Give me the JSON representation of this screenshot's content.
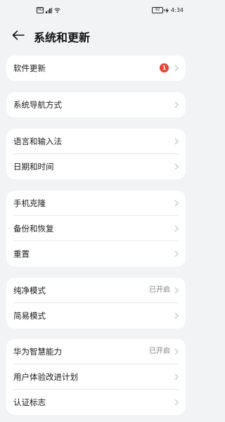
{
  "status_bar": {
    "left_icons": [
      "sim-icon",
      "signal-icon",
      "wifi-icon"
    ],
    "battery_level": "92",
    "time": "4:34"
  },
  "header": {
    "title": "系统和更新"
  },
  "groups": [
    {
      "items": [
        {
          "label": "软件更新",
          "badge": "1"
        }
      ]
    },
    {
      "items": [
        {
          "label": "系统导航方式"
        }
      ]
    },
    {
      "items": [
        {
          "label": "语言和输入法"
        },
        {
          "label": "日期和时间"
        }
      ]
    },
    {
      "items": [
        {
          "label": "手机克隆"
        },
        {
          "label": "备份和恢复"
        },
        {
          "label": "重置"
        }
      ]
    },
    {
      "items": [
        {
          "label": "纯净模式",
          "value": "已开启"
        },
        {
          "label": "简易模式"
        }
      ]
    },
    {
      "items": [
        {
          "label": "华为智慧能力",
          "value": "已开启"
        },
        {
          "label": "用户体验改进计划"
        },
        {
          "label": "认证标志"
        }
      ]
    }
  ],
  "colors": {
    "background": "#f1f3f5",
    "card": "#ffffff",
    "badge": "#e64333",
    "secondary_text": "#808080"
  }
}
